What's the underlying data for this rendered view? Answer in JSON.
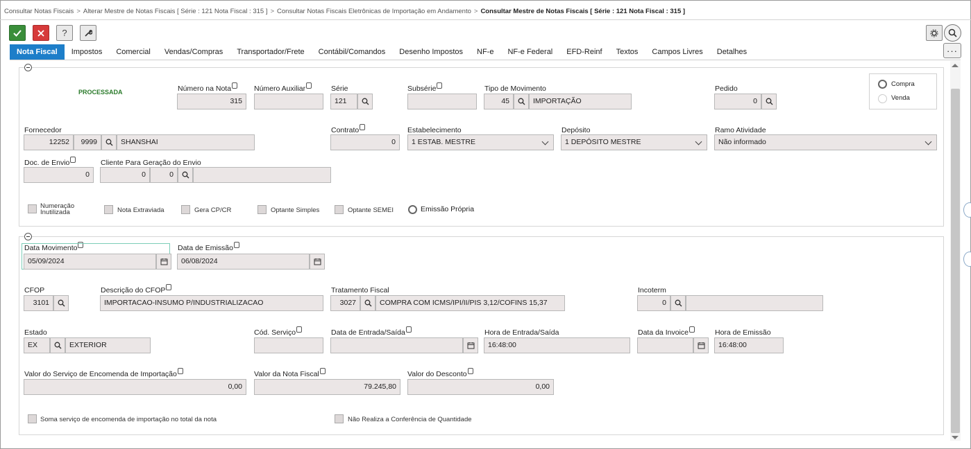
{
  "breadcrumb": {
    "items": [
      "Consultar Notas Fiscais",
      "Alterar Mestre de Notas Fiscais [ Série : 121 Nota Fiscal : 315 ]",
      "Consultar Notas Fiscais Eletrônicas de Importação em Andamento"
    ],
    "separator": ">",
    "current": "Consultar Mestre de Notas Fiscais [ Série : 121 Nota Fiscal : 315 ]"
  },
  "toolbar": {
    "ok_icon": "check-icon",
    "cancel_icon": "x-icon",
    "help_label": "?",
    "tool_icon": "wrench-icon",
    "more_label": "···"
  },
  "tabs": [
    "Nota Fiscal",
    "Impostos",
    "Comercial",
    "Vendas/Compras",
    "Transportador/Frete",
    "Contábil/Comandos",
    "Desenho Impostos",
    "NF-e",
    "NF-e Federal",
    "EFD-Reinf",
    "Textos",
    "Campos Livres",
    "Detalhes"
  ],
  "colors": {
    "accent": "#1d7ec9",
    "ok": "#3a8e3a",
    "cancel": "#d63a3a",
    "status": "#2a7a2a"
  },
  "header": {
    "status": "PROCESSADA",
    "numero_nota": {
      "label": "Número na Nota",
      "value": "315"
    },
    "numero_auxiliar": {
      "label": "Número Auxiliar",
      "value": ""
    },
    "serie": {
      "label": "Série",
      "value": "121"
    },
    "subserie": {
      "label": "Subsérie",
      "value": ""
    },
    "tipo_movimento": {
      "label": "Tipo de Movimento",
      "code": "45",
      "desc": "IMPORTAÇÃO"
    },
    "pedido": {
      "label": "Pedido",
      "value": "0"
    },
    "tipo_options": {
      "compra": "Compra",
      "venda": "Venda"
    },
    "fornecedor": {
      "label": "Fornecedor",
      "code": "12252",
      "sub": "9999",
      "name": "SHANSHAI"
    },
    "contrato": {
      "label": "Contrato",
      "value": "0"
    },
    "estabelecimento": {
      "label": "Estabelecimento",
      "value": "1 ESTAB. MESTRE"
    },
    "deposito": {
      "label": "Depósito",
      "value": "1 DEPÓSITO MESTRE"
    },
    "ramo": {
      "label": "Ramo Atividade",
      "value": "Não informado"
    },
    "doc_envio": {
      "label": "Doc. de Envio",
      "value": "0"
    },
    "cliente_envio": {
      "label": "Cliente Para Geração do Envio",
      "code": "0",
      "sub": "0",
      "name": ""
    },
    "checks": {
      "numeracao": "Numeração Inutilizada",
      "extraviada": "Nota Extraviada",
      "gera_cp": "Gera CP/CR",
      "simples": "Optante Simples",
      "semei": "Optante SEMEI",
      "emissao": "Emissão Própria"
    }
  },
  "details": {
    "data_movimento": {
      "label": "Data Movimento",
      "value": "05/09/2024"
    },
    "data_emissao": {
      "label": "Data de Emissão",
      "value": "06/08/2024"
    },
    "cfop": {
      "label": "CFOP",
      "value": "3101"
    },
    "desc_cfop": {
      "label": "Descrição do CFOP",
      "value": "IMPORTACAO-INSUMO P/INDUSTRIALIZACAO"
    },
    "tratamento": {
      "label": "Tratamento Fiscal",
      "code": "3027",
      "desc": "COMPRA COM ICMS/IPI/II/PIS 3,12/COFINS 15,37"
    },
    "incoterm": {
      "label": "Incoterm",
      "value": "0",
      "desc": ""
    },
    "estado": {
      "label": "Estado",
      "code": "EX",
      "desc": "EXTERIOR"
    },
    "cod_servico": {
      "label": "Cód. Serviço",
      "value": ""
    },
    "data_entrada": {
      "label": "Data de Entrada/Saída",
      "value": ""
    },
    "hora_entrada": {
      "label": "Hora de Entrada/Saída",
      "value": "16:48:00"
    },
    "data_invoice": {
      "label": "Data da Invoice",
      "value": ""
    },
    "hora_emissao": {
      "label": "Hora de Emissão",
      "value": "16:48:00"
    },
    "valor_servico": {
      "label": "Valor do Serviço de Encomenda de Importação",
      "value": "0,00"
    },
    "valor_nota": {
      "label": "Valor da Nota Fiscal",
      "value": "79.245,80"
    },
    "valor_desconto": {
      "label": "Valor do Desconto",
      "value": "0,00"
    },
    "soma_servico": "Soma serviço de encomenda de importação no total da nota",
    "nao_realiza": "Não Realiza a Conferência de Quantidade"
  }
}
